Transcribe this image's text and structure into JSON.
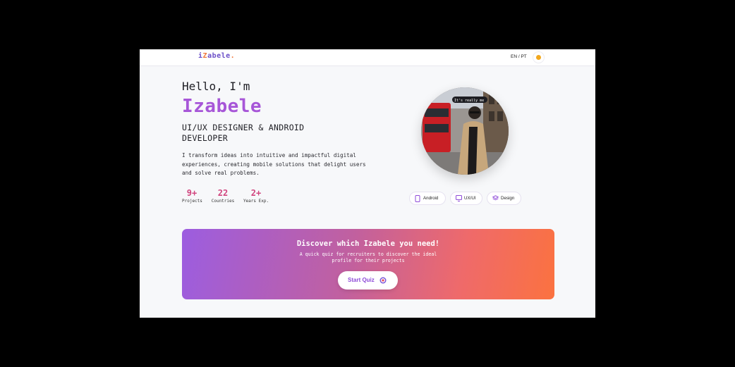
{
  "header": {
    "logo": {
      "prefix": "i",
      "z": "Z",
      "rest": "abele",
      "dot": "."
    },
    "language": "EN / PT"
  },
  "hero": {
    "greeting": "Hello, I'm",
    "name": "Izabele",
    "role": "UI/UX DESIGNER & ANDROID DEVELOPER",
    "description": "I transform ideas into intuitive and impactful digital experiences, creating mobile solutions that delight users and solve real problems.",
    "stats": [
      {
        "value": "9+",
        "label": "Projects"
      },
      {
        "value": "22",
        "label": "Countries"
      },
      {
        "value": "2+",
        "label": "Years Exp."
      }
    ],
    "photo_caption": "It's really me"
  },
  "skills": [
    {
      "label": "Android",
      "icon": "phone-icon"
    },
    {
      "label": "UX/UI",
      "icon": "monitor-icon"
    },
    {
      "label": "Design",
      "icon": "layers-icon"
    }
  ],
  "quiz": {
    "title": "Discover which Izabele you need!",
    "subtitle": "A quick quiz for recruiters to discover the ideal profile for their projects",
    "button": "Start Quiz"
  },
  "colors": {
    "accent": "#a756d8",
    "stat": "#d1457e",
    "banner_start": "#9c5de0",
    "banner_end": "#fb7240"
  }
}
